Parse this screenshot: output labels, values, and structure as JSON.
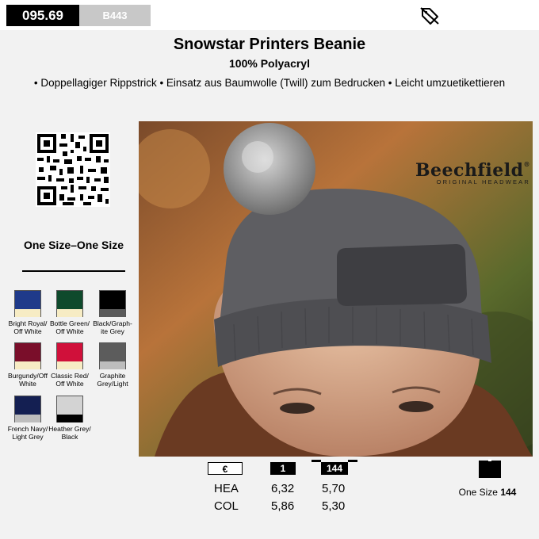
{
  "header": {
    "article_number": "095.69",
    "model_code": "B443",
    "icon": "tag-off-icon"
  },
  "product": {
    "title": "Snowstar Printers Beanie",
    "material": "100% Polyacryl",
    "features": "• Doppellagiger Rippstrick • Einsatz aus Baumwolle (Twill) zum Bedrucken • Leicht umzuetikettieren"
  },
  "qr": {
    "icon": "qr-code-icon"
  },
  "size": {
    "label": "One Size–One Size"
  },
  "colors": [
    {
      "name": "Bright Royal/ Off White",
      "top": "#1f3a8a",
      "bottom": "#f7ecc4"
    },
    {
      "name": "Bottle Green/ Off White",
      "top": "#0f4a2c",
      "bottom": "#f7ecc4"
    },
    {
      "name": "Black/Graph- ite Grey",
      "top": "#000000",
      "bottom": "#5a5a5a"
    },
    {
      "name": "Burgundy/Off White",
      "top": "#7a0e2a",
      "bottom": "#f7ecc4"
    },
    {
      "name": "Classic Red/ Off White",
      "top": "#d0103a",
      "bottom": "#f7ecc4"
    },
    {
      "name": "Graphite Grey/Light",
      "top": "#5c5c5c",
      "bottom": "#bdbdbd"
    },
    {
      "name": "French Navy/ Light Grey",
      "top": "#141f52",
      "bottom": "#bdbdbd"
    },
    {
      "name": "Heather Grey/ Black",
      "top": "#d3d3d3",
      "bottom": "#000000"
    }
  ],
  "photo": {
    "brand_main": "Beechfield",
    "brand_sub": "ORIGINAL HEADWEAR",
    "brand_mark": "®"
  },
  "prices": {
    "currency": "€",
    "qty_1": "1",
    "qty_2": "144",
    "rows": [
      {
        "label": "HEA",
        "p1": "6,32",
        "p2": "5,70"
      },
      {
        "label": "COL",
        "p1": "5,86",
        "p2": "5,30"
      }
    ]
  },
  "packaging": {
    "label": "One Size",
    "value": "144",
    "icon": "box-icon"
  }
}
